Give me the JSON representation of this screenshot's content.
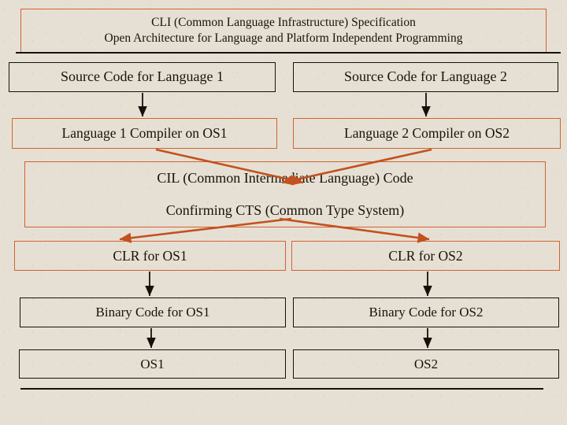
{
  "diagram": {
    "title": {
      "line1": "CLI (Common Language Infrastructure) Specification",
      "line2": "Open Architecture for Language and Platform Independent Programming"
    },
    "nodes": {
      "source_code_1": "Source Code for Language 1",
      "source_code_2": "Source Code for Language 2",
      "compiler_1": "Language 1 Compiler on OS1",
      "compiler_2": "Language 2 Compiler on OS2",
      "cil_line1": "CIL (Common Intermediate Language) Code",
      "cil_line2": "Confirming CTS (Common Type System)",
      "clr_1": "CLR for OS1",
      "clr_2": "CLR for OS2",
      "binary_1": "Binary Code for OS1",
      "binary_2": "Binary Code for OS2",
      "os_1": "OS1",
      "os_2": "OS2"
    },
    "colors": {
      "background": "#e6e0d4",
      "text": "#1a1208",
      "border_black": "#15100a",
      "border_orange": "#d2622f",
      "arrow_black": "#15100a",
      "arrow_orange": "#c2511f"
    }
  }
}
